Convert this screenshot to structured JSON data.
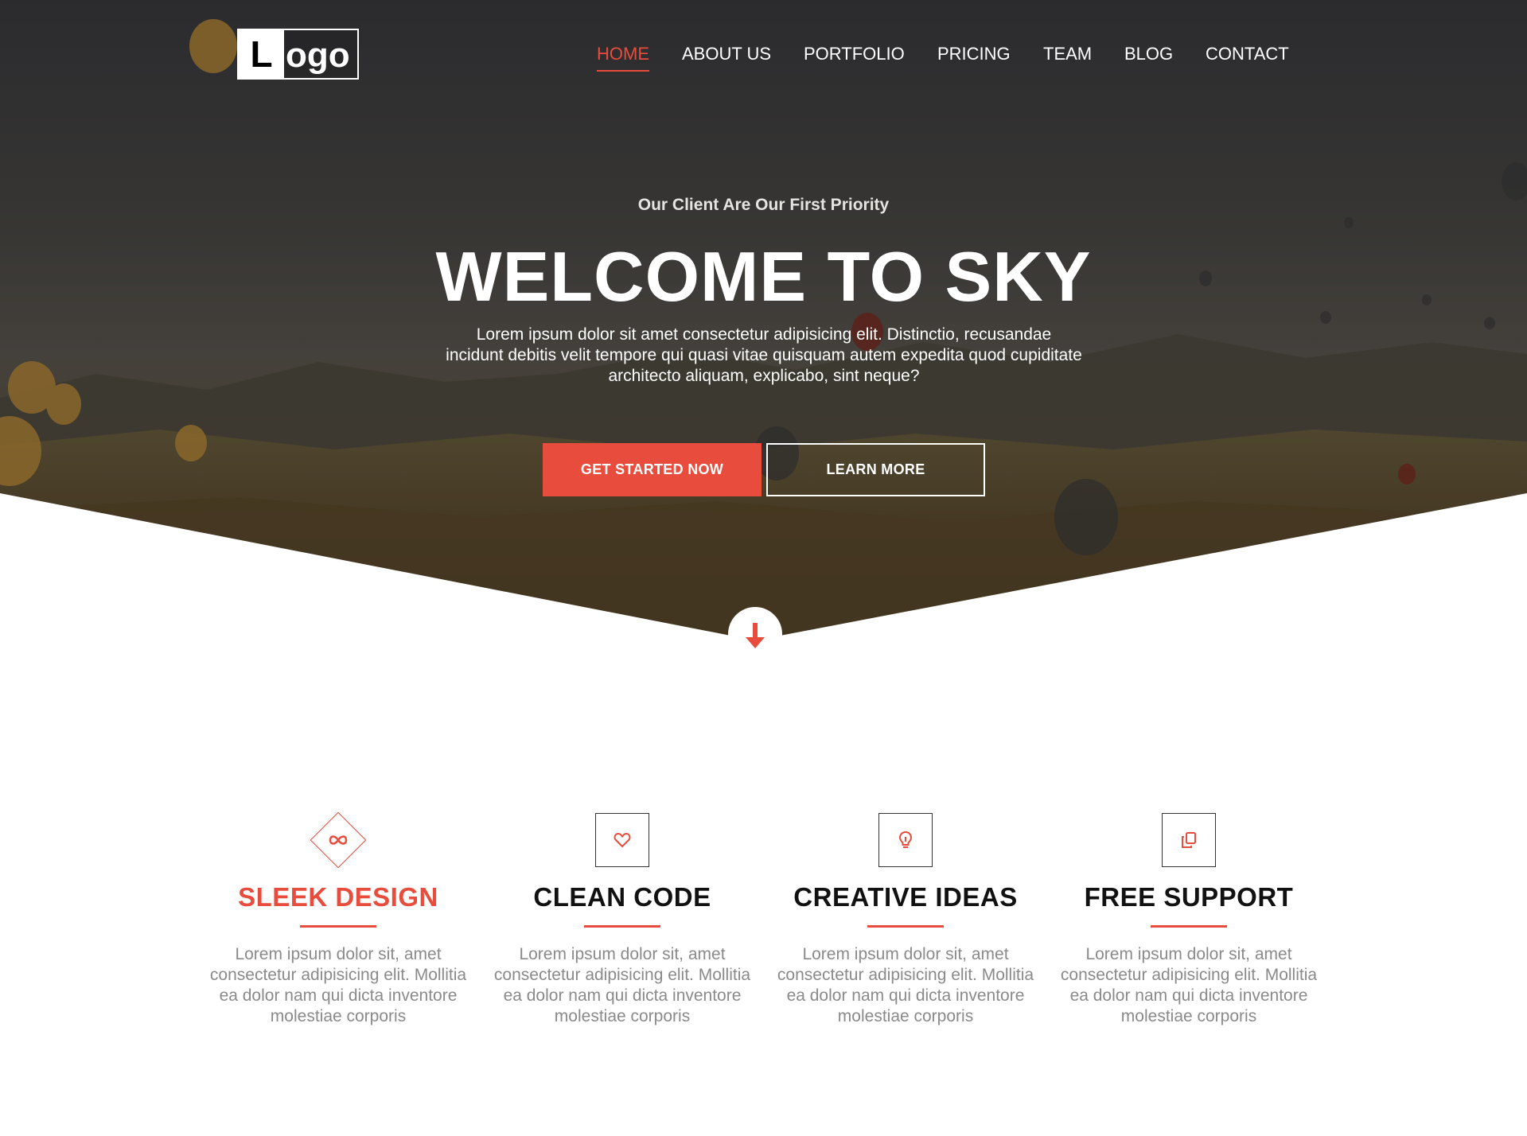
{
  "logo": {
    "first_letter": "L",
    "rest": "ogo"
  },
  "nav": {
    "items": [
      {
        "label": "HOME",
        "active": true
      },
      {
        "label": "ABOUT US",
        "active": false
      },
      {
        "label": "PORTFOLIO",
        "active": false
      },
      {
        "label": "PRICING",
        "active": false
      },
      {
        "label": "TEAM",
        "active": false
      },
      {
        "label": "BLOG",
        "active": false
      },
      {
        "label": "CONTACT",
        "active": false
      }
    ]
  },
  "hero": {
    "tagline": "Our Client Are Our First Priority",
    "title": "WELCOME TO SKY",
    "description": "Lorem ipsum dolor sit amet consectetur adipisicing elit. Distinctio, recusandae incidunt debitis velit tempore qui quasi vitae quisquam autem expedita quod cupiditate architecto aliquam, explicabo, sint neque?",
    "primary_button": "GET STARTED NOW",
    "secondary_button": "LEARN MORE",
    "scroll_icon": "arrow-down-icon"
  },
  "features": [
    {
      "title": "SLEEK DESIGN",
      "icon": "infinity-icon",
      "text": "Lorem ipsum dolor sit, amet consectetur adipisicing elit. Mollitia ea dolor nam qui dicta inventore molestiae corporis"
    },
    {
      "title": "CLEAN CODE",
      "icon": "heart-icon",
      "text": "Lorem ipsum dolor sit, amet consectetur adipisicing elit. Mollitia ea dolor nam qui dicta inventore molestiae corporis"
    },
    {
      "title": "CREATIVE IDEAS",
      "icon": "lightbulb-icon",
      "text": "Lorem ipsum dolor sit, amet consectetur adipisicing elit. Mollitia ea dolor nam qui dicta inventore molestiae corporis"
    },
    {
      "title": "FREE SUPPORT",
      "icon": "copy-icon",
      "text": "Lorem ipsum dolor sit, amet consectetur adipisicing elit. Mollitia ea dolor nam qui dicta inventore molestiae corporis"
    }
  ],
  "colors": {
    "accent": "#e74c3c",
    "text_muted": "#8a8a8a",
    "heading": "#111111"
  }
}
